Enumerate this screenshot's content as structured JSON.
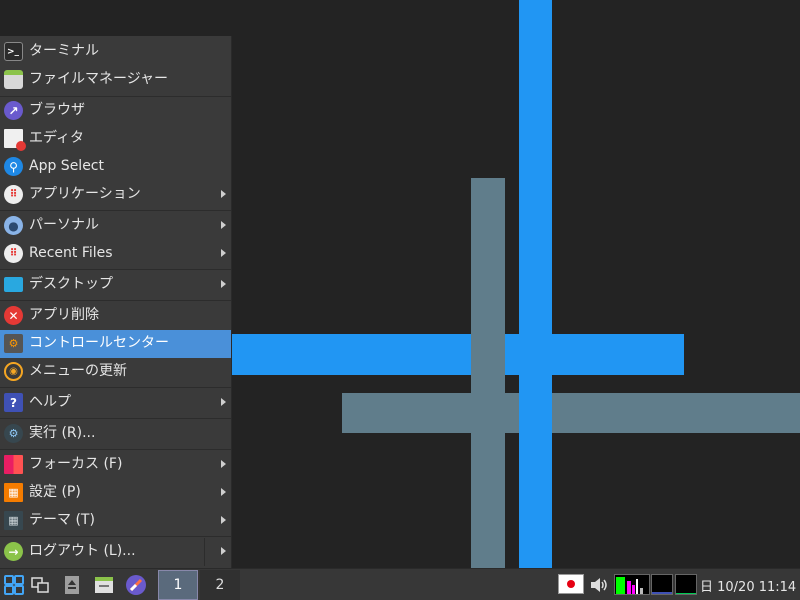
{
  "menu": {
    "items": [
      {
        "label": "ターミナル",
        "icon": "terminal-icon",
        "submenu": false
      },
      {
        "label": "ファイルマネージャー",
        "icon": "file-manager-icon",
        "submenu": false
      },
      {
        "label": "ブラウザ",
        "icon": "browser-icon",
        "submenu": false
      },
      {
        "label": "エディタ",
        "icon": "editor-icon",
        "submenu": false
      },
      {
        "label": "App Select",
        "icon": "search-icon",
        "submenu": false
      },
      {
        "label": "アプリケーション",
        "icon": "applications-icon",
        "submenu": true
      },
      {
        "label": "パーソナル",
        "icon": "user-icon",
        "submenu": true
      },
      {
        "label": "Recent Files",
        "icon": "recent-files-icon",
        "submenu": true
      },
      {
        "label": "デスクトップ",
        "icon": "desktop-icon",
        "submenu": true
      },
      {
        "label": "アプリ削除",
        "icon": "remove-app-icon",
        "submenu": false
      },
      {
        "label": "コントロールセンター",
        "icon": "control-center-icon",
        "submenu": false
      },
      {
        "label": "メニューの更新",
        "icon": "refresh-icon",
        "submenu": false
      },
      {
        "label": "ヘルプ",
        "icon": "help-icon",
        "submenu": true
      },
      {
        "label": "実行 (R)...",
        "icon": "run-icon",
        "submenu": false
      },
      {
        "label": "フォーカス (F)",
        "icon": "focus-icon",
        "submenu": true
      },
      {
        "label": "設定 (P)",
        "icon": "settings-icon",
        "submenu": true
      },
      {
        "label": "テーマ (T)",
        "icon": "theme-icon",
        "submenu": true
      },
      {
        "label": "ログアウト (L)...",
        "icon": "logout-icon",
        "submenu": true
      }
    ],
    "selected": "コントロールセンター"
  },
  "taskbar": {
    "workspaces": [
      "1",
      "2"
    ],
    "active_workspace": "1",
    "clock": "日 10/20 11:14",
    "keyboard_layout": "jp-flag-icon"
  },
  "colors": {
    "accent": "#4a90d9",
    "wallpaper_blue": "#2196f3",
    "wallpaper_grey": "#607d8b"
  }
}
